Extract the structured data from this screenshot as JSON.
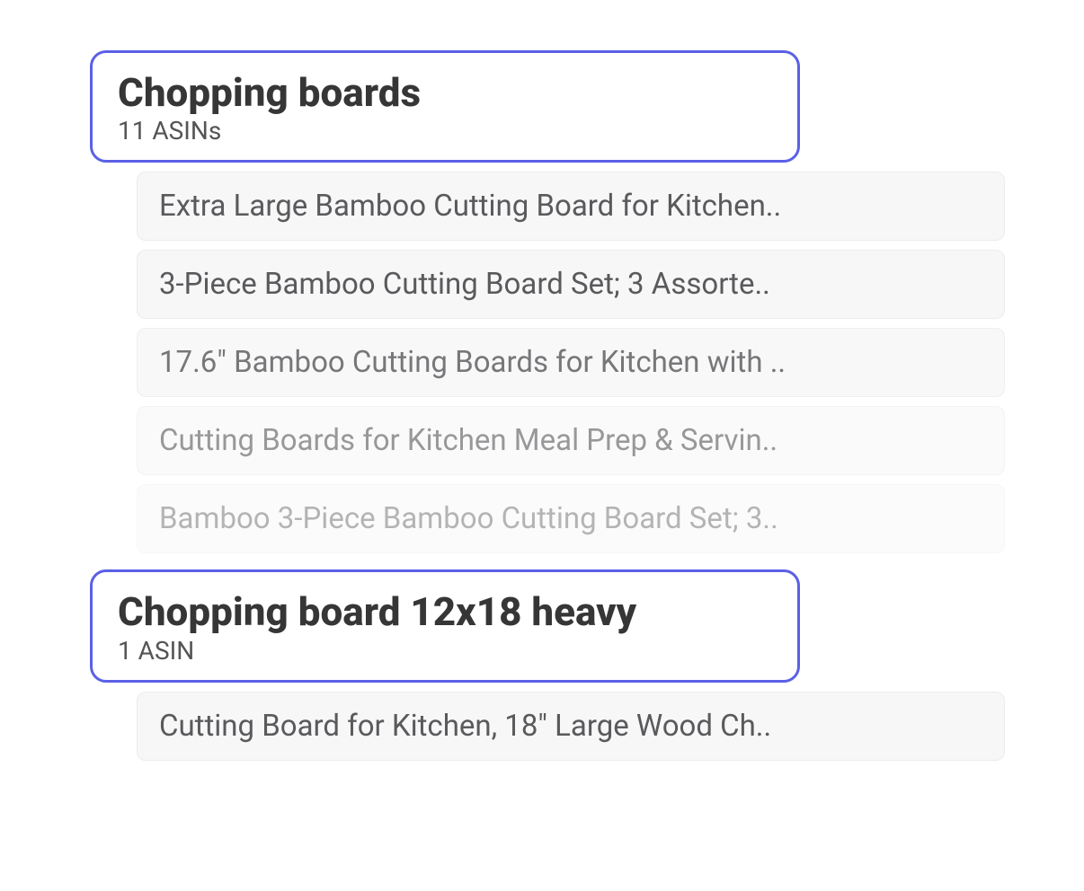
{
  "groups": [
    {
      "title": "Chopping boards",
      "subtitle": "11 ASINs",
      "items": [
        "Extra Large Bamboo Cutting Board for Kitchen..",
        "3-Piece Bamboo Cutting Board Set; 3 Assorte..",
        "17.6\" Bamboo Cutting Boards for Kitchen with ..",
        "Cutting Boards for Kitchen Meal Prep & Servin..",
        "Bamboo 3-Piece Bamboo Cutting Board Set; 3.."
      ]
    },
    {
      "title": "Chopping board 12x18 heavy",
      "subtitle": "1 ASIN",
      "items": [
        "Cutting Board for Kitchen, 18\" Large Wood Ch.."
      ]
    }
  ]
}
